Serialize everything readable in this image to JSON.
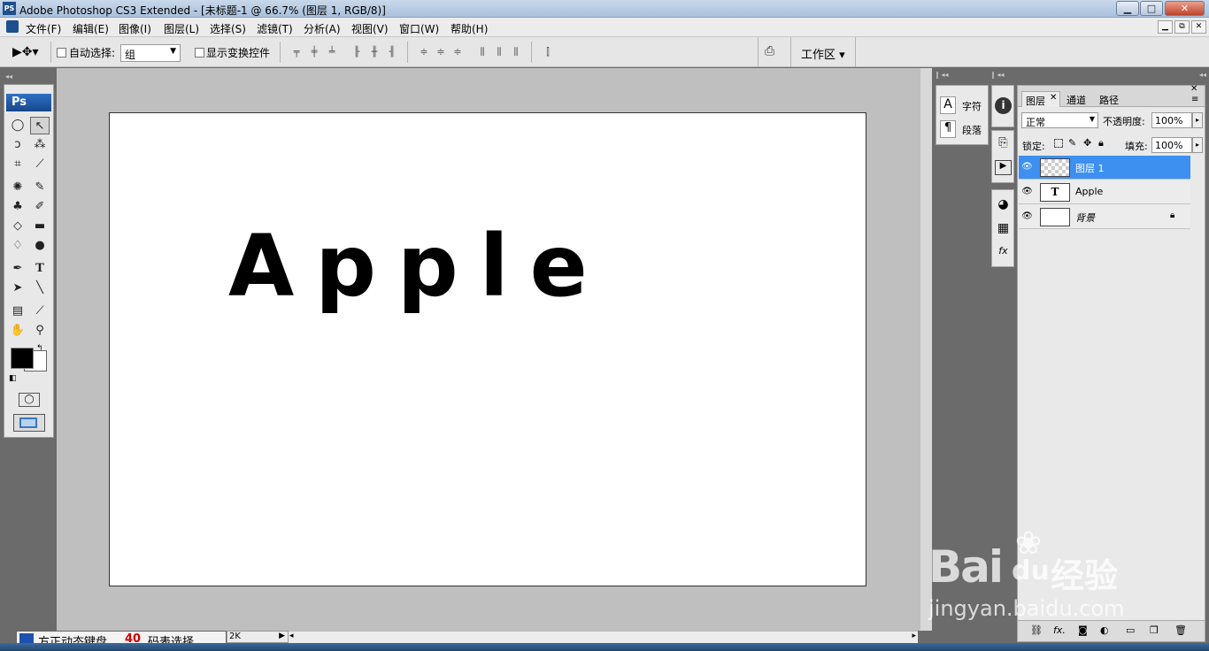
{
  "titlebar": {
    "app_icon": "PS",
    "title": "Adobe Photoshop CS3 Extended - [未标题-1 @ 66.7% (图层 1, RGB/8)]",
    "minimize": "▁",
    "maximize": "□",
    "close": "✕"
  },
  "menubar": {
    "items": [
      "文件(F)",
      "编辑(E)",
      "图像(I)",
      "图层(L)",
      "选择(S)",
      "滤镜(T)",
      "分析(A)",
      "视图(V)",
      "窗口(W)",
      "帮助(H)"
    ],
    "doc_controls": [
      "▁",
      "⧉",
      "✕"
    ]
  },
  "options": {
    "auto_select_label": "自动选择:",
    "auto_select_value": "组",
    "show_transform_label": "显示变换控件",
    "workspace_label": "工作区 ▾"
  },
  "toolbox": {
    "logo": "Ps"
  },
  "canvas": {
    "text": "Apple"
  },
  "side_panels": {
    "char_label": "字符",
    "para_label": "段落"
  },
  "layers_panel": {
    "tabs": [
      "图层",
      "通道",
      "路径"
    ],
    "blend_mode": "正常",
    "opacity_label": "不透明度:",
    "opacity_value": "100%",
    "lock_label": "锁定:",
    "fill_label": "填充:",
    "fill_value": "100%",
    "layers": [
      {
        "name": "图层 1",
        "thumb": "",
        "active": true
      },
      {
        "name": "Apple",
        "thumb": "T",
        "active": false
      },
      {
        "name": "背景",
        "thumb": "",
        "active": false
      }
    ],
    "footer_icons": [
      "link-icon",
      "fx-icon",
      "mask-icon",
      "adjustment-icon",
      "group-icon",
      "new-layer-icon",
      "trash-icon"
    ]
  },
  "statusbar": {
    "ime_text": "方正动态键盘",
    "ime_num": "40",
    "ime_tab": "码表选择",
    "size_text": "2K"
  },
  "watermark": {
    "brand": "Bai",
    "brand2": "du",
    "cn": "经验",
    "url": "jingyan.baidu.com"
  }
}
